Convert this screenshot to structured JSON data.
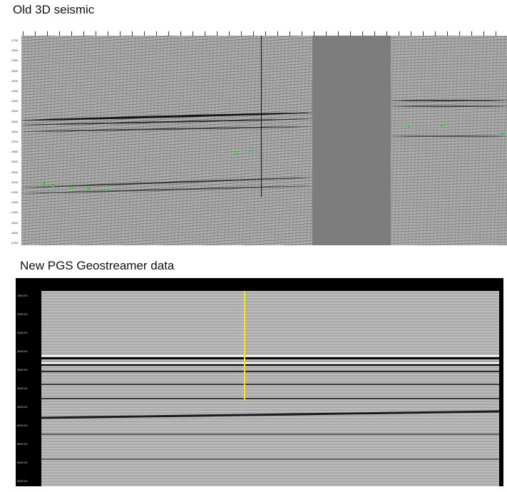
{
  "old": {
    "title": "Old 3D seismic",
    "depth_labels": [
      "-2700",
      "-2800",
      "-2900",
      "-3000",
      "-3100",
      "-3200",
      "-3300",
      "-3400",
      "-3500",
      "-3600",
      "-3700",
      "-3800",
      "-3900",
      "-4000",
      "-4100",
      "-4200",
      "-4300",
      "-4400",
      "-4500",
      "-4600",
      "-4700"
    ],
    "pick_color": "#22dd22"
  },
  "new": {
    "title": "New PGS Geostreamer data",
    "depth_labels": [
      "1800.00",
      "2000.00",
      "2500.00",
      "3000.00",
      "3500.00",
      "4000.00",
      "4500.00",
      "5000.00",
      "5500.00",
      "6000.00",
      "6500.00"
    ],
    "highlight_color": "#f2e22a"
  }
}
